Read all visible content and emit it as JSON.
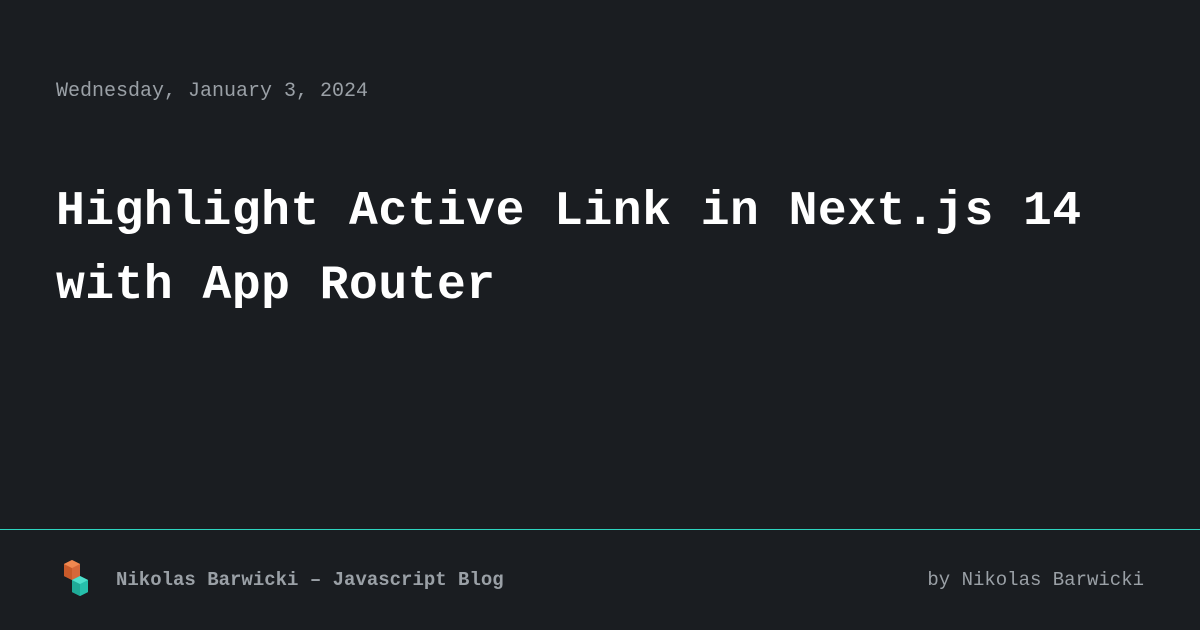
{
  "date": "Wednesday, January 3, 2024",
  "title": "Highlight Active Link in Next.js 14 with App Router",
  "footer": {
    "siteName": "Nikolas Barwicki – Javascript Blog",
    "author": "by Nikolas Barwicki"
  },
  "colors": {
    "background": "#1a1d21",
    "accent": "#2dd4bf",
    "textMuted": "#9aa0a6",
    "textPrimary": "#ffffff",
    "logoOrange": "#e8743b",
    "logoTeal": "#2dd4bf"
  }
}
